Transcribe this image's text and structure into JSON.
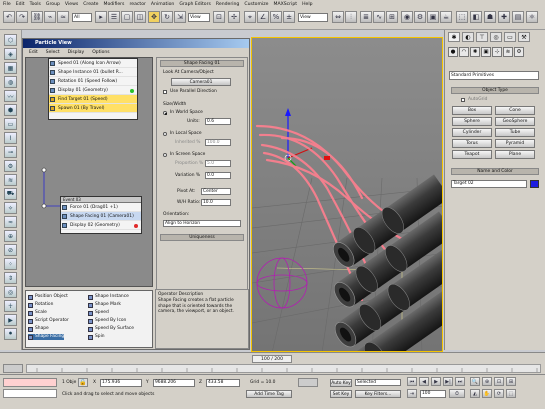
{
  "menu": [
    "File",
    "Edit",
    "Tools",
    "Group",
    "Views",
    "Create",
    "Modifiers",
    "reactor",
    "Animation",
    "Graph Editors",
    "Rendering",
    "Customize",
    "MAXScript",
    "Help"
  ],
  "toolbar": {
    "selection_filter": "All",
    "view_dropdown": "View",
    "named_sel": "View"
  },
  "particle_view": {
    "title": "Particle View",
    "menu": [
      "Edit",
      "Select",
      "Display",
      "Options"
    ],
    "event1": {
      "rows": [
        "Speed 01 (Along Icon Arrow)",
        "Shape Instance 01 (bullet R...",
        "Rotation 01 (Speed Follow)",
        "Display 01 (Geometry)",
        "Find Target 01 (Speed)",
        "Spawn 01 (By Travel)"
      ]
    },
    "event2": {
      "title": "Event 03",
      "rows": [
        "Force 01 (Drag01 +1)",
        "Shape Facing 01 (Camera01)",
        "Display 02 (Geometry)"
      ]
    },
    "params": {
      "rollout_title": "Shape Facing 01",
      "look_at_label": "Look At Camera/Object",
      "look_at_value": "Camera01",
      "use_parallel": "Use Parallel Direction",
      "size_width_label": "Size/Width",
      "in_world_space": "In World Space",
      "units_label": "Units:",
      "units_value": "0.6",
      "in_local_space": "In Local Space",
      "inherited_label": "Inherited %",
      "inherited_value": "100.0",
      "in_screen_space": "In Screen Space",
      "proportion_label": "Proportion %",
      "proportion_value": "5.0",
      "variation_label": "Variation %",
      "variation_value": "0.0",
      "pivot_at_label": "Pivot At:",
      "pivot_at_value": "Center",
      "wh_ratio_label": "W/H Ratio:",
      "wh_ratio_value": "10.0",
      "orientation_label": "Orientation:",
      "orientation_value": "Align to Horizon",
      "uniqueness_label": "Uniqueness"
    },
    "depot": {
      "col1": [
        "Position Object",
        "Rotation",
        "Scale",
        "Script Operator",
        "Shape",
        "Shape Facing"
      ],
      "col2": [
        "Shape Instance",
        "Shape Mark",
        "Speed",
        "Speed By Icon",
        "Speed By Surface",
        "Spin"
      ]
    },
    "description_title": "Operator Description",
    "description": "Shape Facing creates a flat particle shape that is oriented towards the camera, the viewport, or an object."
  },
  "command_panel": {
    "dropdown": "Standard Primitives",
    "object_type_header": "Object Type",
    "autogrid": "AutoGrid",
    "buttons": [
      "Box",
      "Cone",
      "Sphere",
      "GeoSphere",
      "Cylinder",
      "Tube",
      "Torus",
      "Pyramid",
      "Teapot",
      "Plane"
    ],
    "name_color_header": "Name and Color",
    "name_value": "Target 02"
  },
  "timeline": {
    "frame_label": "100 / 200"
  },
  "status": {
    "selection": "1 Obje",
    "x_label": "X",
    "x_value": "175.936",
    "y_label": "Y",
    "y_value": "9688.206",
    "z_label": "Z",
    "z_value": "433.58",
    "grid": "Grid = 10.0",
    "prompt": "Click and drag to select and move objects",
    "add_time_tag": "Add Time Tag",
    "auto_key": "Auto Key",
    "selected_option": "Selected",
    "set_key": "Set Key",
    "key_filters": "Key Filters...",
    "frame_current": "100"
  },
  "colors": {
    "accent": "#f4c400",
    "graph_bg": "#8a8a8a",
    "title": "#0a246a",
    "particles": "#ff6f7f"
  }
}
